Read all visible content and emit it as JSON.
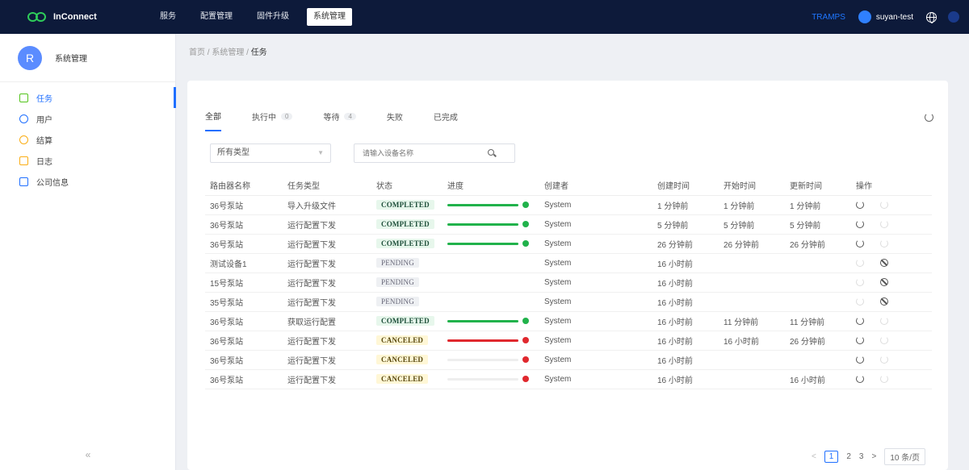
{
  "header": {
    "logo": "InConnect",
    "nav": [
      "服务",
      "配置管理",
      "固件升级",
      "系统管理"
    ],
    "active_nav": "系统管理",
    "link": "TRAMPS",
    "username": "suyan-test"
  },
  "sidebar": {
    "avatar_letter": "R",
    "title": "系统管理",
    "items": [
      {
        "label": "任务",
        "icon": "task-icon",
        "color": "#52c41a"
      },
      {
        "label": "用户",
        "icon": "user-icon",
        "color": "#1f6fff"
      },
      {
        "label": "结算",
        "icon": "billing-icon",
        "color": "#faad14"
      },
      {
        "label": "日志",
        "icon": "log-icon",
        "color": "#faad14"
      },
      {
        "label": "公司信息",
        "icon": "company-icon",
        "color": "#1f6fff"
      }
    ],
    "collapse": "«"
  },
  "breadcrumb": {
    "home": "首页",
    "section": "系统管理",
    "current": "任务",
    "sep": "/"
  },
  "tabs": [
    {
      "label": "全部",
      "badge": ""
    },
    {
      "label": "执行中",
      "badge": "0"
    },
    {
      "label": "等待",
      "badge": "4"
    },
    {
      "label": "失败",
      "badge": ""
    },
    {
      "label": "已完成",
      "badge": ""
    }
  ],
  "filters": {
    "type_select": "所有类型",
    "search_placeholder": "请输入设备名称"
  },
  "table": {
    "columns": [
      "路由器名称",
      "任务类型",
      "状态",
      "进度",
      "创建者",
      "创建时间",
      "开始时间",
      "更新时间",
      "操作"
    ],
    "rows": [
      {
        "name": "36号泵站",
        "type": "导入升级文件",
        "status": "COMPLETED",
        "progress": 1.0,
        "creator": "System",
        "created": "1 分钟前",
        "started": "1 分钟前",
        "updated": "1 分钟前",
        "actions": [
          "refresh",
          "dim-refresh"
        ]
      },
      {
        "name": "36号泵站",
        "type": "运行配置下发",
        "status": "COMPLETED",
        "progress": 1.0,
        "creator": "System",
        "created": "5 分钟前",
        "started": "5 分钟前",
        "updated": "5 分钟前",
        "actions": [
          "refresh",
          "dim-refresh"
        ]
      },
      {
        "name": "36号泵站",
        "type": "运行配置下发",
        "status": "COMPLETED",
        "progress": 1.0,
        "creator": "System",
        "created": "26 分钟前",
        "started": "26 分钟前",
        "updated": "26 分钟前",
        "actions": [
          "refresh",
          "dim-refresh"
        ]
      },
      {
        "name": "测试设备1",
        "type": "运行配置下发",
        "status": "PENDING",
        "progress": null,
        "creator": "System",
        "created": "16 小时前",
        "started": "",
        "updated": "",
        "actions": [
          "dim-refresh",
          "stop"
        ]
      },
      {
        "name": "15号泵站",
        "type": "运行配置下发",
        "status": "PENDING",
        "progress": null,
        "creator": "System",
        "created": "16 小时前",
        "started": "",
        "updated": "",
        "actions": [
          "dim-refresh",
          "stop"
        ]
      },
      {
        "name": "35号泵站",
        "type": "运行配置下发",
        "status": "PENDING",
        "progress": null,
        "creator": "System",
        "created": "16 小时前",
        "started": "",
        "updated": "",
        "actions": [
          "dim-refresh",
          "stop"
        ]
      },
      {
        "name": "36号泵站",
        "type": "获取运行配置",
        "status": "COMPLETED",
        "progress": 1.0,
        "creator": "System",
        "created": "16 小时前",
        "started": "11 分钟前",
        "updated": "11 分钟前",
        "actions": [
          "refresh",
          "dim-refresh"
        ]
      },
      {
        "name": "36号泵站",
        "type": "运行配置下发",
        "status": "CANCELED",
        "progress": 1.0,
        "creator": "System",
        "created": "16 小时前",
        "started": "16 小时前",
        "updated": "26 分钟前",
        "actions": [
          "refresh",
          "dim-refresh"
        ]
      },
      {
        "name": "36号泵站",
        "type": "运行配置下发",
        "status": "CANCELED",
        "progress": 0.0,
        "creator": "System",
        "created": "16 小时前",
        "started": "",
        "updated": "",
        "actions": [
          "refresh",
          "dim-refresh"
        ]
      },
      {
        "name": "36号泵站",
        "type": "运行配置下发",
        "status": "CANCELED",
        "progress": 0.0,
        "creator": "System",
        "created": "16 小时前",
        "started": "",
        "updated": "16 小时前",
        "actions": [
          "refresh",
          "dim-refresh"
        ]
      }
    ]
  },
  "pagination": {
    "prev": "<",
    "pages": [
      "1",
      "2",
      "3"
    ],
    "current": "1",
    "next": ">",
    "page_size": "10 条/页"
  },
  "colors": {
    "accent": "#1f6fff",
    "success": "#21b24b",
    "danger": "#e0282e",
    "header_bg": "#0d1a3a"
  }
}
